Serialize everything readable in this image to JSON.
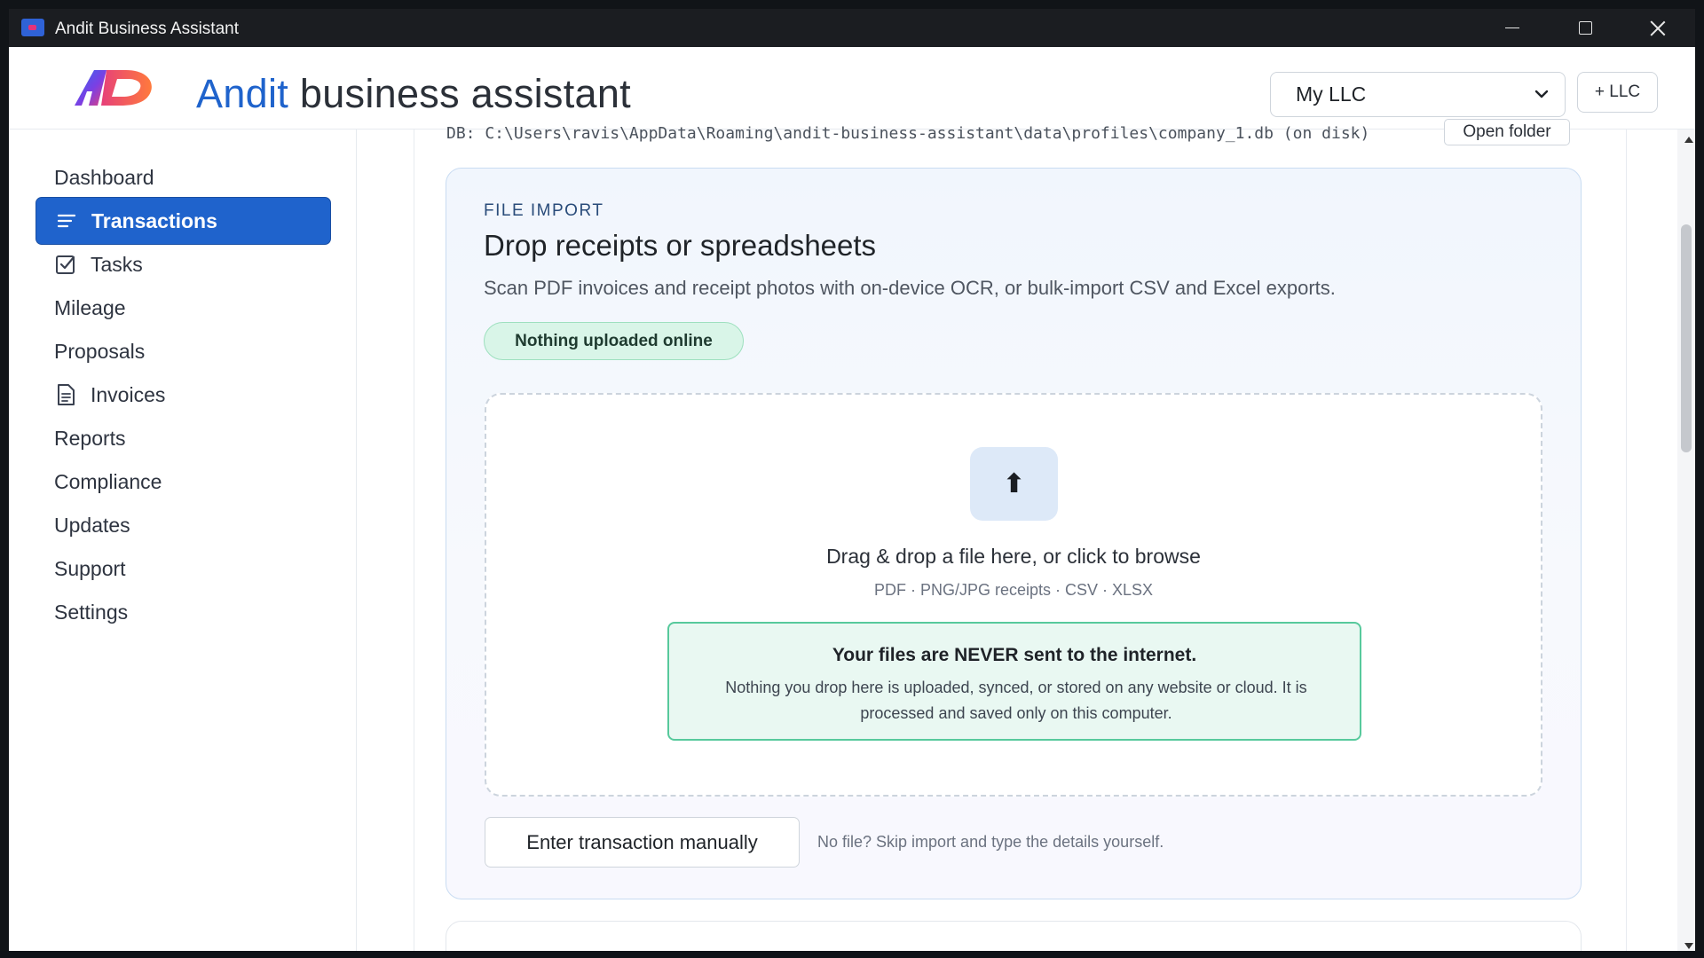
{
  "window": {
    "title": "Andit Business Assistant"
  },
  "header": {
    "title_accent": "Andit",
    "title_rest": " business assistant",
    "company_selected": "My LLC",
    "add_company_label": "+ LLC"
  },
  "sidebar": {
    "items": [
      {
        "label": "Dashboard",
        "icon": ""
      },
      {
        "label": "Transactions",
        "icon": "list-icon",
        "active": true
      },
      {
        "label": "Tasks",
        "icon": "checkbox-icon"
      },
      {
        "label": "Mileage",
        "icon": ""
      },
      {
        "label": "Proposals",
        "icon": ""
      },
      {
        "label": "Invoices",
        "icon": "document-icon"
      },
      {
        "label": "Reports",
        "icon": ""
      },
      {
        "label": "Compliance",
        "icon": ""
      },
      {
        "label": "Updates",
        "icon": ""
      },
      {
        "label": "Support",
        "icon": ""
      },
      {
        "label": "Settings",
        "icon": ""
      }
    ]
  },
  "db": {
    "path_text": "DB: C:\\Users\\ravis\\AppData\\Roaming\\andit-business-assistant\\data\\profiles\\company_1.db (on disk)",
    "open_folder_label": "Open folder"
  },
  "import": {
    "kicker": "FILE IMPORT",
    "title": "Drop receipts or spreadsheets",
    "description": "Scan PDF invoices and receipt photos with on-device OCR, or bulk-import CSV and Excel exports.",
    "badge": "Nothing uploaded online",
    "upload_icon": "⬆",
    "drop_title": "Drag & drop a file here, or click to browse",
    "drop_formats": "PDF · PNG/JPG receipts · CSV · XLSX",
    "notice_title": "Your files are NEVER sent to the internet.",
    "notice_body": "Nothing you drop here is uploaded, synced, or stored on any website or cloud. It is processed and saved only on this computer.",
    "manual_button": "Enter transaction manually",
    "manual_hint": "No file? Skip import and type the details yourself."
  },
  "colors": {
    "accent": "#1f63cc",
    "success_bg": "#e9f8f2",
    "success_border": "#57c99c",
    "titlebar": "#1b1d21"
  }
}
